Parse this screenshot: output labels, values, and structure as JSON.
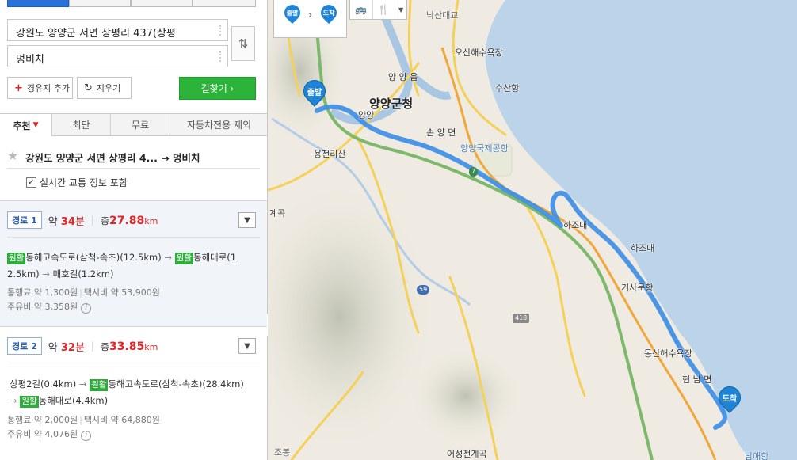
{
  "search": {
    "origin": "강원도 양양군 서면 상평리 437(상평",
    "destination": "멍비치",
    "add_waypoint_label": "경유지 추가",
    "clear_label": "지우기",
    "go_label": "길찾기 ›"
  },
  "option_tabs": {
    "recommend": "추천",
    "shortest": "최단",
    "free": "무료",
    "no_highway": "자동차전용 제외"
  },
  "summary": {
    "title": "강원도 양양군 서면 상평리 4... → 멍비치",
    "realtime_label": "실시간 교통 정보 포함",
    "realtime_checked": true
  },
  "routes": [
    {
      "badge": "경로 1",
      "time_prefix": "약",
      "time_value": "34",
      "time_unit": "분",
      "dist_prefix": "총",
      "dist_value": "27.88",
      "dist_unit": "km",
      "toll": "통행료 약 1,300원",
      "taxi": "택시비 약 53,900원",
      "fuel": "주유비 약 3,358원",
      "steps": {
        "s1_tag": "원활",
        "s1_text": "동해고속도로(삼척-속초)(12.5km)",
        "s2_tag": "원활",
        "s2_text": "동해대로(1",
        "s2_cont": "2.5km)",
        "s3_text": "매호길(1.2km)"
      }
    },
    {
      "badge": "경로 2",
      "time_prefix": "약",
      "time_value": "32",
      "time_unit": "분",
      "dist_prefix": "총",
      "dist_value": "33.85",
      "dist_unit": "km",
      "toll": "통행료 약 2,000원",
      "taxi": "택시비 약 64,880원",
      "fuel": "주유비 약 4,076원",
      "steps": {
        "s1_text": "상평2길(0.4km)",
        "s2_tag": "원활",
        "s2_text": "동해고속도로(삼척-속초)(28.4km)",
        "s3_tag": "원활",
        "s3_text": "동해대로(4.4km)"
      }
    }
  ],
  "map": {
    "toolbar_start": "출발",
    "toolbar_end": "도착",
    "pin_start": "출발",
    "pin_end": "도착",
    "labels": {
      "county_office": "양양군청",
      "yangyang_eup": "양 양 읍",
      "yangyang": "양양",
      "son_yang": "손 양 면",
      "airport": "양양국제공항",
      "osan_beach": "오산해수욕장",
      "susan_port": "수산항",
      "hajodae": "하조대",
      "hajodae2": "하조대",
      "gisamun_port": "기사문항",
      "dongsan_beach": "동산해수욕장",
      "hyeonnam": "현 남 면",
      "namae_port": "남애항",
      "yongcheon": "용천리산",
      "eoseong_valley": "어성전계곡",
      "gye": "계곡",
      "jobong": "조봉",
      "naksan_bridge": "낙산대교",
      "route7": "7",
      "route59": "59",
      "route418": "418"
    }
  },
  "colors": {
    "route_blue": "#3a8ee6",
    "accent_red": "#e32626",
    "go_green": "#2bb33a",
    "sea": "#bcd4ea"
  }
}
